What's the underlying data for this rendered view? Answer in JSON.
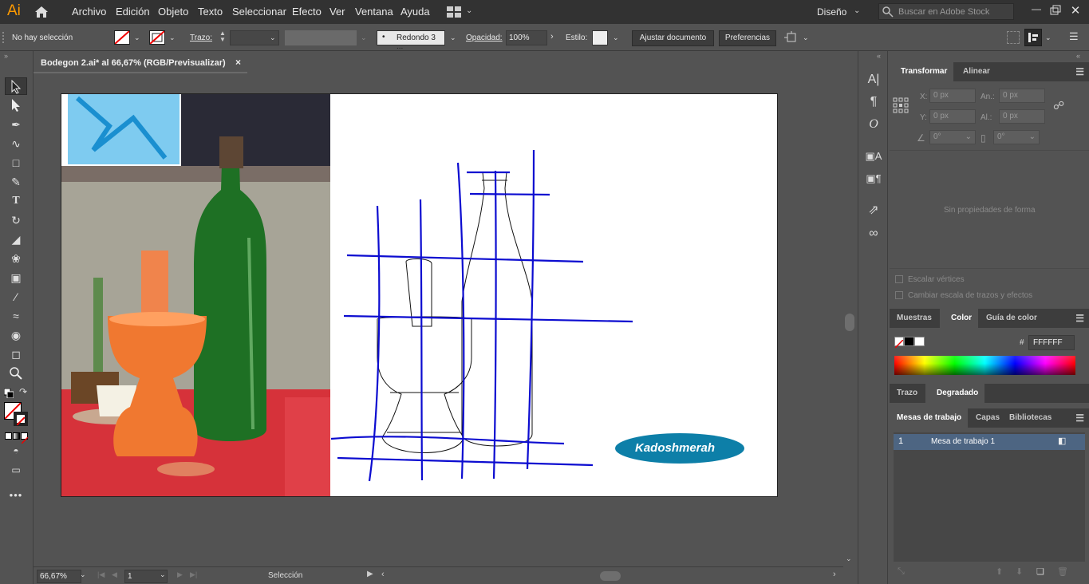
{
  "menubar": {
    "app_logo": "Ai",
    "items": [
      "Archivo",
      "Edición",
      "Objeto",
      "Texto",
      "Seleccionar",
      "Efecto",
      "Ver",
      "Ventana",
      "Ayuda"
    ],
    "workspace": "Diseño",
    "search_placeholder": "Buscar en Adobe Stock"
  },
  "control": {
    "selection_status": "No hay selección",
    "stroke_label": "Trazo:",
    "brush": "Redondo 3 ...",
    "opacity_label": "Opacidad:",
    "opacity_value": "100%",
    "style_label": "Estilo:",
    "fit_button": "Ajustar documento",
    "prefs_button": "Preferencias"
  },
  "document": {
    "tab_title": "Bodegon 2.ai* al 66,67% (RGB/Previsualizar)",
    "close": "×",
    "watermark": "Kadoshmerah"
  },
  "status": {
    "zoom": "66,67%",
    "artboard_num": "1",
    "tool": "Selección"
  },
  "transform": {
    "tabs": [
      "Transformar",
      "Alinear"
    ],
    "x_label": "X:",
    "x_value": "0 px",
    "y_label": "Y:",
    "y_value": "0 px",
    "w_label": "An.:",
    "w_value": "0 px",
    "h_label": "Al.:",
    "h_value": "0 px",
    "rot_value": "0°",
    "shear_value": "0°",
    "empty_msg": "Sin propiedades de forma",
    "scale_corners": "Escalar vértices",
    "scale_strokes": "Cambiar escala de trazos y efectos"
  },
  "color": {
    "tabs": [
      "Muestras",
      "Color",
      "Guía de color"
    ],
    "hex_label": "#",
    "hex_value": "FFFFFF"
  },
  "gradient": {
    "tabs": [
      "Trazo",
      "Degradado"
    ]
  },
  "artboards": {
    "tabs": [
      "Mesas de trabajo",
      "Capas",
      "Bibliotecas"
    ],
    "rows": [
      {
        "num": "1",
        "name": "Mesa de trabajo 1"
      }
    ]
  },
  "colors": {
    "accent_blue": "#0000cc",
    "watermark_bg": "#0d7fa8",
    "menubar_bg": "#323232",
    "panel_bg": "#535353"
  }
}
